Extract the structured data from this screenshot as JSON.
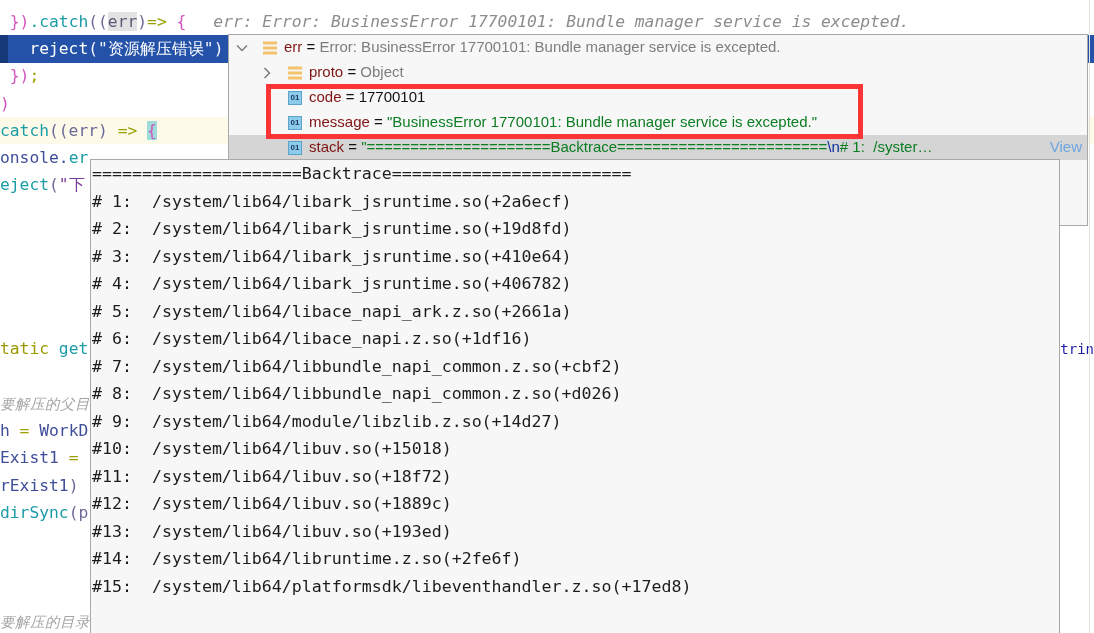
{
  "editor": {
    "lines": [
      {
        "kind": "plain",
        "tokens": [
          {
            "kind": "brace",
            "text": " })"
          },
          {
            "kind": "method",
            "text": ".catch"
          },
          {
            "kind": "paren",
            "text": "(("
          },
          {
            "kind": "param",
            "text": "err"
          },
          {
            "kind": "paren",
            "text": ")"
          },
          {
            "kind": "operator",
            "text": "=> "
          },
          {
            "kind": "brace",
            "text": "{"
          }
        ],
        "hint": "err: Error: BusinessError 17700101: Bundle manager service is excepted."
      },
      {
        "kind": "execution",
        "tokens": [
          {
            "kind": "method",
            "text": "   reject"
          },
          {
            "kind": "paren",
            "text": "(\""
          },
          {
            "kind": "string",
            "text": "资源解压错误"
          },
          {
            "kind": "paren",
            "text": "\")"
          }
        ]
      },
      {
        "kind": "plain",
        "tokens": [
          {
            "kind": "brace",
            "text": " })"
          },
          {
            "kind": "operator",
            "text": ";"
          }
        ]
      },
      {
        "kind": "plain",
        "tokens": [
          {
            "kind": "brace",
            "text": ")"
          }
        ]
      },
      {
        "kind": "caret",
        "tokens": [
          {
            "kind": "method",
            "text": "catch"
          },
          {
            "kind": "paren",
            "text": "((err) "
          },
          {
            "kind": "operator",
            "text": "=> "
          },
          {
            "kind": "brace_match",
            "text": "{"
          }
        ]
      },
      {
        "kind": "plain",
        "tokens": [
          {
            "kind": "ident",
            "text": "onsole."
          },
          {
            "kind": "method",
            "text": "er"
          }
        ]
      },
      {
        "kind": "plain",
        "tokens": [
          {
            "kind": "method",
            "text": "eject"
          },
          {
            "kind": "paren",
            "text": "("
          },
          {
            "kind": "string",
            "text": "\"下"
          }
        ]
      },
      {
        "kind": "blank"
      },
      {
        "kind": "blank"
      },
      {
        "kind": "blank"
      },
      {
        "kind": "blank"
      },
      {
        "kind": "blank"
      },
      {
        "kind": "plain",
        "tokens": [
          {
            "kind": "keyword",
            "text": "tatic "
          },
          {
            "kind": "method",
            "text": "get"
          }
        ],
        "right_tokens": [
          {
            "kind": "type",
            "text": "trin"
          }
        ]
      },
      {
        "kind": "blank"
      },
      {
        "kind": "plain",
        "tokens": [
          {
            "kind": "comment",
            "text": "要解压的父目"
          }
        ]
      },
      {
        "kind": "plain",
        "tokens": [
          {
            "kind": "ident",
            "text": "h "
          },
          {
            "kind": "operator",
            "text": "= "
          },
          {
            "kind": "ident",
            "text": "WorkD"
          }
        ]
      },
      {
        "kind": "plain",
        "tokens": [
          {
            "kind": "ident",
            "text": "Exist1 "
          },
          {
            "kind": "operator",
            "text": "="
          }
        ]
      },
      {
        "kind": "plain",
        "tokens": [
          {
            "kind": "ident",
            "text": "rExist1"
          },
          {
            "kind": "paren",
            "text": ")"
          }
        ]
      },
      {
        "kind": "plain",
        "tokens": [
          {
            "kind": "method",
            "text": "dirSync"
          },
          {
            "kind": "paren",
            "text": "(p"
          }
        ]
      },
      {
        "kind": "blank"
      },
      {
        "kind": "blank"
      },
      {
        "kind": "blank"
      },
      {
        "kind": "plain",
        "tokens": [
          {
            "kind": "comment",
            "text": "要解压的目录"
          }
        ]
      }
    ]
  },
  "variables_popup": {
    "variables": [
      {
        "name": "err",
        "separator": "=",
        "kind": "object",
        "expanded": true,
        "value_parts": [
          {
            "kind": "description",
            "text": "Error: BusinessError 17700101: Bundle manager service is excepted."
          }
        ],
        "selected": false,
        "marked": false,
        "children": [
          {
            "name": "proto",
            "separator": "=",
            "kind": "object",
            "expanded": false,
            "value_parts": [
              {
                "kind": "description",
                "text": "Object"
              }
            ],
            "selected": false,
            "marked": false
          },
          {
            "name": "code",
            "separator": "=",
            "kind": "primitive",
            "tag": "01",
            "value_parts": [
              {
                "kind": "number",
                "text": "17700101"
              }
            ],
            "selected": false,
            "marked": true
          },
          {
            "name": "message",
            "separator": "=",
            "kind": "primitive",
            "tag": "01",
            "value_parts": [
              {
                "kind": "string",
                "text": "\"BusinessError 17700101: Bundle manager service is excepted.\""
              }
            ],
            "selected": false,
            "marked": true
          },
          {
            "name": "stack",
            "separator": "=",
            "kind": "primitive",
            "tag": "01",
            "value_parts": [
              {
                "kind": "string",
                "text": "\"=====================Backtrace========================"
              },
              {
                "kind": "escape",
                "text": "\\n"
              },
              {
                "kind": "string",
                "text": "# 1:  /syster…"
              }
            ],
            "link": "View",
            "selected": true,
            "marked": false
          }
        ]
      }
    ]
  },
  "backtrace_popup": {
    "lines": [
      "=====================Backtrace========================",
      "# 1:  /system/lib64/libark_jsruntime.so(+2a6ecf)",
      "# 2:  /system/lib64/libark_jsruntime.so(+19d8fd)",
      "# 3:  /system/lib64/libark_jsruntime.so(+410e64)",
      "# 4:  /system/lib64/libark_jsruntime.so(+406782)",
      "# 5:  /system/lib64/libace_napi_ark.z.so(+2661a)",
      "# 6:  /system/lib64/libace_napi.z.so(+1df16)",
      "# 7:  /system/lib64/libbundle_napi_common.z.so(+cbf2)",
      "# 8:  /system/lib64/libbundle_napi_common.z.so(+d026)",
      "# 9:  /system/lib64/module/libzlib.z.so(+14d27)",
      "#10:  /system/lib64/libuv.so(+15018)",
      "#11:  /system/lib64/libuv.so(+18f72)",
      "#12:  /system/lib64/libuv.so(+1889c)",
      "#13:  /system/lib64/libuv.so(+193ed)",
      "#14:  /system/lib64/libruntime.z.so(+2fe6f)",
      "#15:  /system/lib64/platformsdk/libeventhandler.z.so(+17ed8)"
    ]
  }
}
